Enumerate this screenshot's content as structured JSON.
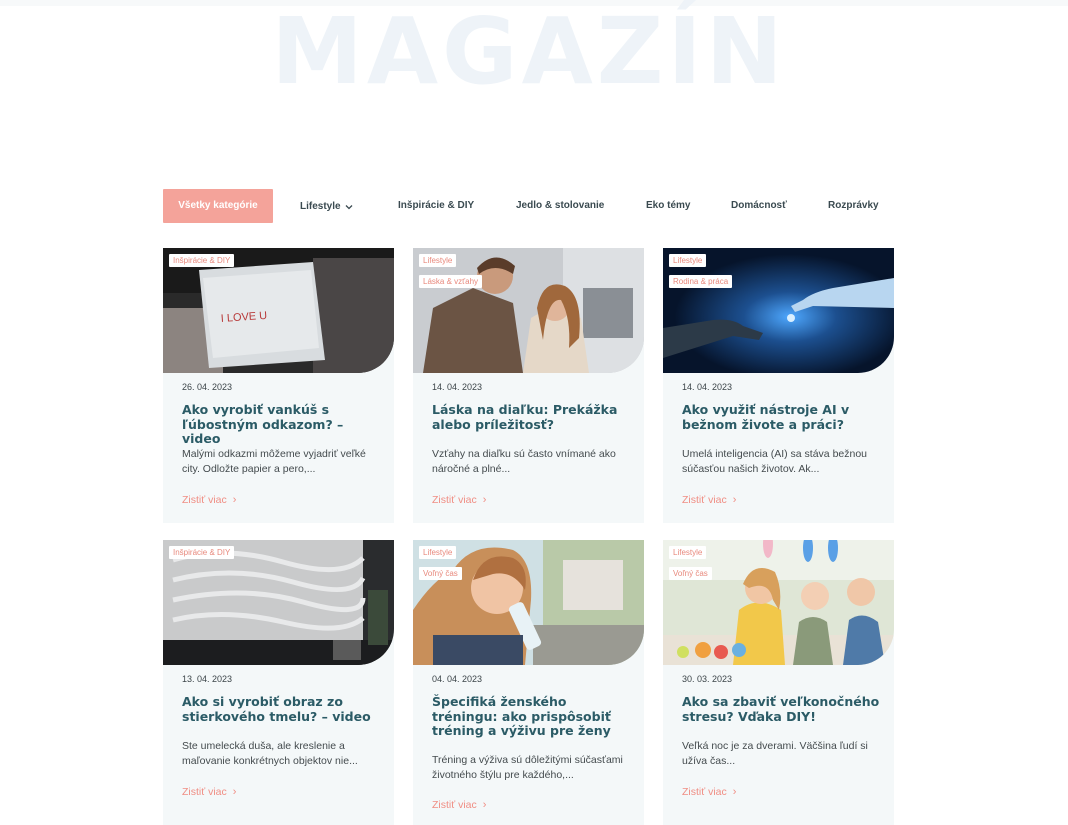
{
  "hero": {
    "title": "MAGAZÍN"
  },
  "nav": {
    "items": [
      {
        "label": "Všetky kategórie",
        "active": true
      },
      {
        "label": "Lifestyle",
        "dropdown": true
      },
      {
        "label": "Inšpirácie & DIY"
      },
      {
        "label": "Jedlo & stolovanie"
      },
      {
        "label": "Eko témy"
      },
      {
        "label": "Domácnosť"
      },
      {
        "label": "Rozprávky"
      }
    ],
    "dropdown_icon": "chevron-down-icon"
  },
  "cards": [
    {
      "tags": [
        "Inšpirácie & DIY"
      ],
      "date": "26. 04. 2023",
      "title": "Ako vyrobiť vankúš s ľúbostným odkazom? – video",
      "excerpt": "Malými odkazmi môžeme vyjadriť veľké city. Odložte papier a pero,...",
      "more": "Zistiť viac",
      "image": "pillow-photo",
      "image_text": "I LOVE U"
    },
    {
      "tags": [
        "Lifestyle",
        "Láska & vzťahy"
      ],
      "date": "14. 04. 2023",
      "title": "Láska na diaľku: Prekážka alebo príležitosť?",
      "excerpt": "Vzťahy na diaľku sú často vnímané ako náročné a plné...",
      "more": "Zistiť viac",
      "image": "couple-photo"
    },
    {
      "tags": [
        "Lifestyle",
        "Rodina & práca"
      ],
      "date": "14. 04. 2023",
      "title": "Ako využiť nástroje AI v bežnom živote a práci?",
      "excerpt": "Umelá inteligencia (AI) sa stáva bežnou súčasťou našich životov. Ak...",
      "more": "Zistiť viac",
      "image": "ai-hands-photo"
    },
    {
      "tags": [
        "Inšpirácie & DIY"
      ],
      "date": "13. 04. 2023",
      "title": "Ako si vyrobiť obraz zo stierkového tmelu? – video",
      "excerpt": "Ste umelecká duša, ale kreslenie a maľovanie konkrétnych objektov nie...",
      "more": "Zistiť viac",
      "image": "textured-painting-photo"
    },
    {
      "tags": [
        "Lifestyle",
        "Voľný čas"
      ],
      "date": "04. 04. 2023",
      "title": "Špecifiká ženského tréningu: ako prispôsobiť tréning a výživu pre ženy",
      "excerpt": "Tréning a výživa sú dôležitými súčasťami životného štýlu pre každého,...",
      "more": "Zistiť viac",
      "image": "woman-drinking-photo"
    },
    {
      "tags": [
        "Lifestyle",
        "Voľný čas"
      ],
      "date": "30. 03. 2023",
      "title": "Ako sa zbaviť veľkonočného stresu? Vďaka DIY!",
      "excerpt": "Veľká noc je za dverami. Väčšina ľudí si užíva čas...",
      "more": "Zistiť viac",
      "image": "easter-family-photo"
    }
  ],
  "colors": {
    "accent": "#f4a39a",
    "title": "#2b5b66",
    "link": "#f08e84",
    "card_bg": "#f4f8f9",
    "hero_text": "#eef3f8"
  }
}
